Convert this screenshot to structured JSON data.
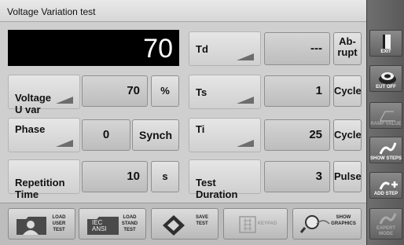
{
  "title": "Voltage Variation test",
  "display": {
    "value": "70"
  },
  "left_rows": [
    {
      "label": "Voltage\nU var",
      "value": "70",
      "unit": "%"
    },
    {
      "label": "Phase",
      "value": "0",
      "unit": "Synch"
    },
    {
      "label": "Repetition\nTime",
      "value": "10",
      "unit": "s"
    }
  ],
  "right_rows": [
    {
      "label": "Td",
      "value": "---",
      "unit": "Ab-\nrupt"
    },
    {
      "label": "Ts",
      "value": "1",
      "unit": "Cycle"
    },
    {
      "label": "Ti",
      "value": "25",
      "unit": "Cycle"
    },
    {
      "label": "Test\nDuration",
      "value": "3",
      "unit": "Pulse"
    }
  ],
  "bottom_buttons": [
    {
      "label": "LOAD\nUSER\nTEST",
      "icon": "folder-user-icon"
    },
    {
      "label": "LOAD\nSTAND\nTEST",
      "icon": "folder-standard-icon"
    },
    {
      "label": "SAVE\nTEST",
      "icon": "disk-icon"
    },
    {
      "label": "KEYPAD",
      "icon": "keypad-icon",
      "disabled": true
    },
    {
      "label": "SHOW\nGRAPHICS",
      "icon": "magnifier-icon"
    }
  ],
  "folder_badge": {
    "standard": "IEC\nANSI"
  },
  "right_buttons": [
    {
      "label": "EXIT",
      "icon": "door-icon"
    },
    {
      "label": "EUT OFF",
      "icon": "power-icon"
    },
    {
      "label": "RAMP VALUE",
      "icon": "ramp-icon",
      "disabled": true
    },
    {
      "label": "SHOW STEPS",
      "icon": "steps-icon"
    },
    {
      "label": "ADD STEP",
      "icon": "add-step-icon"
    },
    {
      "label": "EXPERT\nMODE",
      "icon": "expert-icon",
      "disabled": true
    }
  ],
  "colors": {
    "accent": "#000000",
    "panel": "#d8d8d8",
    "sidebar": "#636363"
  }
}
